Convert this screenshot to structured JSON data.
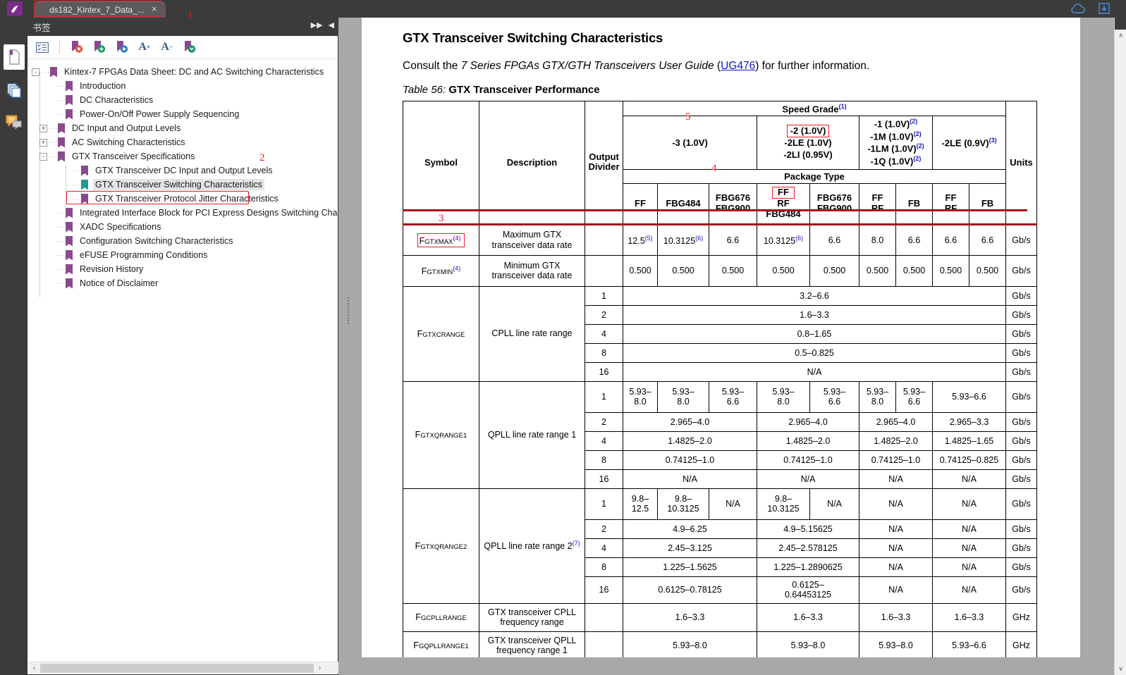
{
  "window": {
    "tab_label": "ds182_Kintex_7_Data_...",
    "tab_close": "×",
    "logo_glyph": "✎"
  },
  "annotations": [
    {
      "num": "1"
    },
    {
      "num": "2"
    },
    {
      "num": "3"
    },
    {
      "num": "4"
    },
    {
      "num": "5"
    }
  ],
  "annotation_numbers": {
    "tab": "1",
    "bookmark": "2",
    "symbol": "3",
    "package": "4",
    "speedgrade": "5"
  },
  "bookmarks_panel": {
    "title": "书签",
    "collapse_glyph": "▶▶",
    "close_glyph": "◀",
    "toolbar": [
      {
        "name": "expand-collapse-icon",
        "glyph": "☰"
      },
      {
        "name": "delete-bookmark-icon",
        "glyph": "⚑"
      },
      {
        "name": "add-bookmark-icon",
        "glyph": "⚑"
      },
      {
        "name": "goto-bookmark-icon",
        "glyph": "⚑"
      },
      {
        "name": "increase-text-icon",
        "glyph": "A"
      },
      {
        "name": "decrease-text-icon",
        "glyph": "A"
      },
      {
        "name": "bookmark-options-icon",
        "glyph": "⚑"
      }
    ],
    "toolbar_sup_plus": "+",
    "toolbar_sup_minus": "−",
    "tree": [
      {
        "label": "Kintex-7 FPGAs Data Sheet: DC and AC Switching Characteristics",
        "level": 0,
        "toggle": "-",
        "selected": false
      },
      {
        "label": "Introduction",
        "level": 1,
        "toggle": "",
        "selected": false
      },
      {
        "label": "DC Characteristics",
        "level": 1,
        "toggle": "",
        "selected": false
      },
      {
        "label": "Power-On/Off Power Supply Sequencing",
        "level": 1,
        "toggle": "",
        "selected": false
      },
      {
        "label": "DC Input and Output Levels",
        "level": 1,
        "toggle": "+",
        "selected": false
      },
      {
        "label": "AC Switching Characteristics",
        "level": 1,
        "toggle": "+",
        "selected": false
      },
      {
        "label": "GTX Transceiver Specifications",
        "level": 1,
        "toggle": "-",
        "selected": false
      },
      {
        "label": "GTX Transceiver DC Input and Output Levels",
        "level": 2,
        "toggle": "",
        "selected": false
      },
      {
        "label": "GTX Transceiver Switching Characteristics",
        "level": 2,
        "toggle": "",
        "selected": true
      },
      {
        "label": "GTX Transceiver Protocol Jitter Characteristics",
        "level": 2,
        "toggle": "",
        "selected": false
      },
      {
        "label": "Integrated Interface Block for PCI Express Designs Switching Characte",
        "level": 1,
        "toggle": "",
        "selected": false
      },
      {
        "label": "XADC Specifications",
        "level": 1,
        "toggle": "",
        "selected": false
      },
      {
        "label": "Configuration Switching Characteristics",
        "level": 1,
        "toggle": "",
        "selected": false
      },
      {
        "label": "eFUSE Programming Conditions",
        "level": 1,
        "toggle": "",
        "selected": false
      },
      {
        "label": "Revision History",
        "level": 1,
        "toggle": "",
        "selected": false
      },
      {
        "label": "Notice of Disclaimer",
        "level": 1,
        "toggle": "",
        "selected": false
      }
    ],
    "hscroll_left": "‹",
    "hscroll_right": "›"
  },
  "document": {
    "heading": "GTX Transceiver Switching Characteristics",
    "paragraph_prefix": "Consult the ",
    "paragraph_italic": "7 Series FPGAs GTX/GTH Transceivers User Guide",
    "paragraph_mid": " (",
    "paragraph_link": "UG476",
    "paragraph_suffix": ") for further information.",
    "table_caption_num": "Table  56:",
    "table_caption_name": "GTX Transceiver Performance"
  },
  "table": {
    "col_headers": {
      "symbol": "Symbol",
      "description": "Description",
      "output_divider": "Output\nDivider",
      "speed_grade": "Speed Grade",
      "speed_grade_sup": "(1)",
      "package_type": "Package Type",
      "units": "Units"
    },
    "speed_grades": [
      {
        "lines": [
          "-3 (1.0V)"
        ],
        "sups": [
          ""
        ]
      },
      {
        "lines": [
          "-2 (1.0V)",
          "-2LE (1.0V)",
          "-2LI (0.95V)"
        ],
        "sups": [
          "",
          "",
          ""
        ],
        "boxed_first": true
      },
      {
        "lines": [
          "-1 (1.0V)",
          "-1M (1.0V)",
          "-1LM (1.0V)",
          "-1Q (1.0V)"
        ],
        "sups": [
          "(2)",
          "(2)",
          "(2)",
          "(2)"
        ]
      },
      {
        "lines": [
          "-2LE (0.9V)"
        ],
        "sups": [
          "(3)"
        ]
      }
    ],
    "packages": [
      "FF",
      "FBG484",
      "FBG676\nFBG900",
      "FF\nRF\nFBG484",
      "FBG676\nFBG900",
      "FF\nRF",
      "FB",
      "FF\nRF",
      "FB"
    ],
    "units_header": "Units",
    "rows": [
      {
        "symbol_main": "F",
        "symbol_sub": "GTXMAX",
        "symbol_sup": "(4)",
        "description": "Maximum GTX transceiver data rate",
        "divider": "",
        "values": [
          {
            "text": "12.5",
            "sup": "(5)"
          },
          {
            "text": "10.3125",
            "sup": "(6)"
          },
          {
            "text": "6.6",
            "sup": ""
          },
          {
            "text": "10.3125",
            "sup": "(6)"
          },
          {
            "text": "6.6",
            "sup": ""
          },
          {
            "text": "8.0",
            "sup": ""
          },
          {
            "text": "6.6",
            "sup": ""
          },
          {
            "text": "6.6",
            "sup": ""
          },
          {
            "text": "6.6",
            "sup": ""
          }
        ],
        "units": "Gb/s",
        "redline_above": true
      },
      {
        "symbol_main": "F",
        "symbol_sub": "GTXMIN",
        "symbol_sup": "(4)",
        "description": "Minimum GTX transceiver data rate",
        "divider": "",
        "values": [
          {
            "text": "0.500",
            "sup": ""
          },
          {
            "text": "0.500",
            "sup": ""
          },
          {
            "text": "0.500",
            "sup": ""
          },
          {
            "text": "0.500",
            "sup": ""
          },
          {
            "text": "0.500",
            "sup": ""
          },
          {
            "text": "0.500",
            "sup": ""
          },
          {
            "text": "0.500",
            "sup": ""
          },
          {
            "text": "0.500",
            "sup": ""
          },
          {
            "text": "0.500",
            "sup": ""
          }
        ],
        "units": "Gb/s",
        "redline_above": false
      }
    ],
    "crange": {
      "symbol_main": "F",
      "symbol_sub": "GTXCRANGE",
      "description": "CPLL line rate range",
      "dividers": [
        "1",
        "2",
        "4",
        "8",
        "16"
      ],
      "values": [
        "3.2–6.6",
        "1.6–3.3",
        "0.8–1.65",
        "0.5–0.825",
        "N/A"
      ],
      "units": [
        "Gb/s",
        "Gb/s",
        "Gb/s",
        "Gb/s",
        "Gb/s"
      ]
    },
    "qrange1": {
      "symbol_main": "F",
      "symbol_sub": "GTXQRANGE1",
      "description": "QPLL line rate range 1",
      "rows": [
        {
          "divider": "1",
          "cells": [
            "5.93–\n8.0",
            "5.93–\n8.0",
            "5.93–\n6.6",
            "5.93–\n8.0",
            "5.93–\n6.6",
            "5.93–\n8.0",
            "5.93–\n6.6",
            "5.93–6.6"
          ],
          "spans": [
            1,
            1,
            1,
            1,
            1,
            1,
            1,
            2
          ],
          "units": "Gb/s"
        },
        {
          "divider": "2",
          "cells": [
            "2.965–4.0",
            "2.965–4.0",
            "2.965–4.0",
            "2.965–3.3"
          ],
          "spans": [
            3,
            2,
            2,
            2
          ],
          "units": "Gb/s"
        },
        {
          "divider": "4",
          "cells": [
            "1.4825–2.0",
            "1.4825–2.0",
            "1.4825–2.0",
            "1.4825–1.65"
          ],
          "spans": [
            3,
            2,
            2,
            2
          ],
          "units": "Gb/s"
        },
        {
          "divider": "8",
          "cells": [
            "0.74125–1.0",
            "0.74125–1.0",
            "0.74125–1.0",
            "0.74125–0.825"
          ],
          "spans": [
            3,
            2,
            2,
            2
          ],
          "units": "Gb/s"
        },
        {
          "divider": "16",
          "cells": [
            "N/A",
            "N/A",
            "N/A",
            "N/A"
          ],
          "spans": [
            3,
            2,
            2,
            2
          ],
          "units": "Gb/s"
        }
      ]
    },
    "qrange2": {
      "symbol_main": "F",
      "symbol_sub": "GTXQRANGE2",
      "description_pre": "QPLL line rate range 2",
      "description_sup": "(7)",
      "rows": [
        {
          "divider": "1",
          "cells": [
            "9.8–\n12.5",
            "9.8–\n10.3125",
            "N/A",
            "9.8–\n10.3125",
            "N/A",
            "N/A",
            "N/A"
          ],
          "spans": [
            1,
            1,
            1,
            1,
            1,
            2,
            2
          ],
          "units": "Gb/s"
        },
        {
          "divider": "2",
          "cells": [
            "4.9–6.25",
            "4.9–5.15625",
            "N/A",
            "N/A"
          ],
          "spans": [
            3,
            2,
            2,
            2
          ],
          "units": "Gb/s"
        },
        {
          "divider": "4",
          "cells": [
            "2.45–3.125",
            "2.45–2.578125",
            "N/A",
            "N/A"
          ],
          "spans": [
            3,
            2,
            2,
            2
          ],
          "units": "Gb/s"
        },
        {
          "divider": "8",
          "cells": [
            "1.225–1.5625",
            "1.225–1.2890625",
            "N/A",
            "N/A"
          ],
          "spans": [
            3,
            2,
            2,
            2
          ],
          "units": "Gb/s"
        },
        {
          "divider": "16",
          "cells": [
            "0.6125–0.78125",
            "0.6125–\n0.64453125",
            "N/A",
            "N/A"
          ],
          "spans": [
            3,
            2,
            2,
            2
          ],
          "units": "Gb/s"
        }
      ]
    },
    "tail_rows": [
      {
        "symbol_main": "F",
        "symbol_sub": "GCPLLRANGE",
        "description": "GTX transceiver CPLL frequency range",
        "cells": [
          "1.6–3.3",
          "1.6–3.3",
          "1.6–3.3",
          "1.6–3.3"
        ],
        "spans": [
          3,
          2,
          2,
          2
        ],
        "units": "GHz"
      },
      {
        "symbol_main": "F",
        "symbol_sub": "GQPLLRANGE1",
        "description": "GTX transceiver QPLL frequency range 1",
        "cells": [
          "5.93–8.0",
          "5.93–8.0",
          "5.93–8.0",
          "5.93–6.6"
        ],
        "spans": [
          3,
          2,
          2,
          2
        ],
        "units": "GHz"
      }
    ]
  },
  "scrollbars": {
    "up_glyph": "∧",
    "down_glyph": "∨"
  }
}
